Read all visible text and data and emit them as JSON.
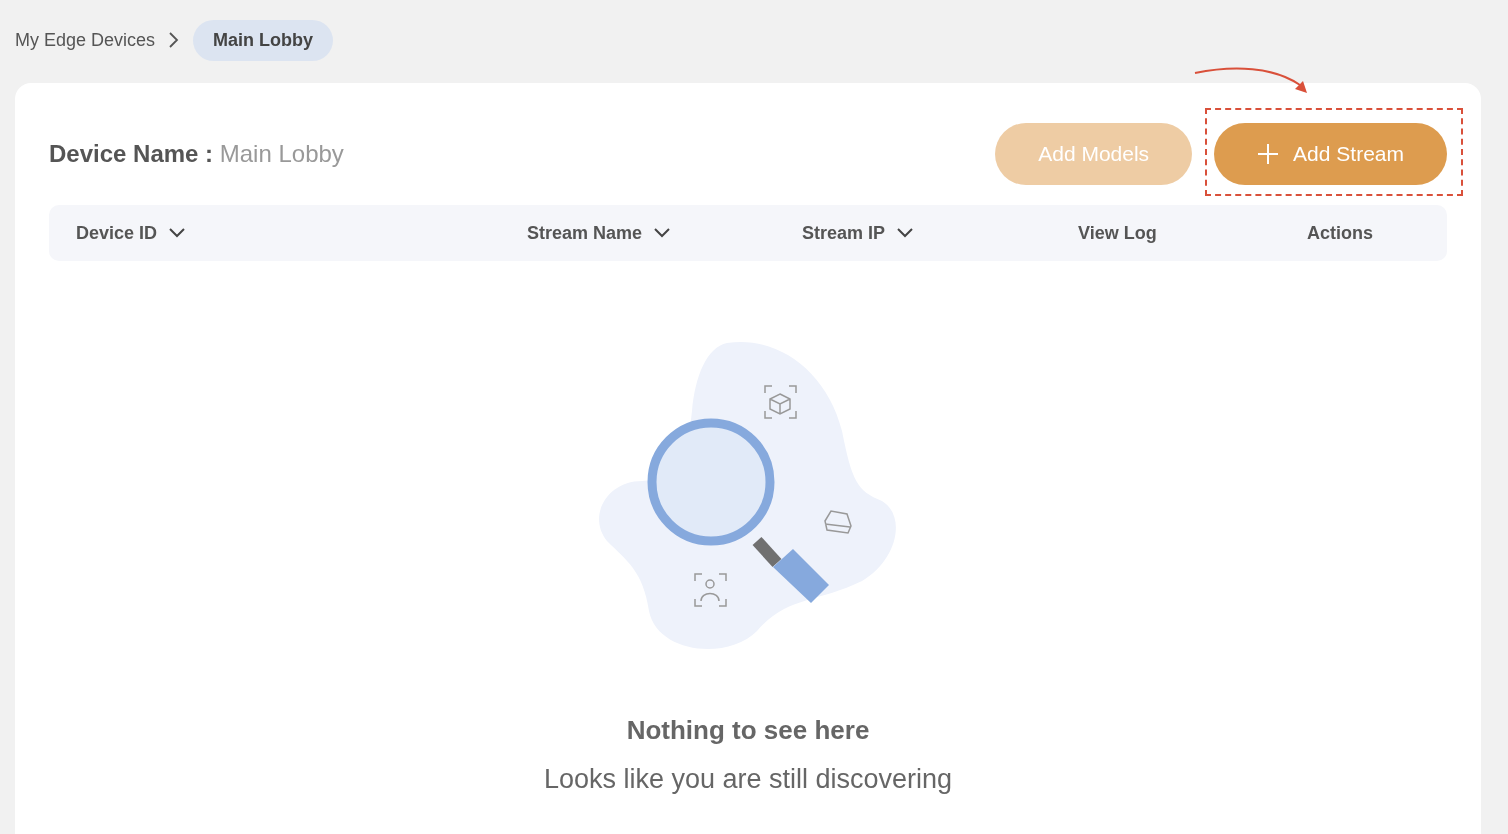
{
  "breadcrumb": [
    {
      "label": "My Edge Devices",
      "selected": false
    },
    {
      "label": "Main Lobby",
      "selected": true
    }
  ],
  "device": {
    "label": "Device Name :",
    "value": "Main Lobby"
  },
  "buttons": [
    {
      "kind": "plain",
      "label": "Add Models",
      "disabled": true,
      "highlighted": false
    },
    {
      "kind": "add",
      "label": "Add Stream",
      "disabled": false,
      "highlighted": true
    }
  ],
  "table": {
    "columns": [
      {
        "label": "Device ID",
        "sortable": true
      },
      {
        "label": "Stream Name",
        "sortable": true
      },
      {
        "label": "Stream IP",
        "sortable": true
      },
      {
        "label": "View Log",
        "sortable": false
      },
      {
        "label": "Actions",
        "sortable": false
      }
    ]
  },
  "empty_state": {
    "title": "Nothing to see here",
    "subtitle": "Looks like you are still discovering"
  }
}
